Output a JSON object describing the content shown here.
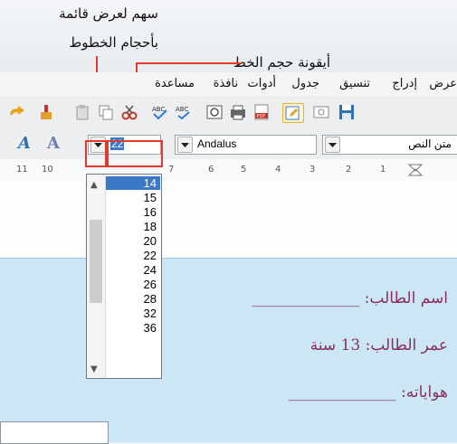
{
  "callouts": {
    "arrow_label_line1": "سهم لعرض قائمة",
    "arrow_label_line2": "بأحجام الخطوط",
    "icon_label": "أيقونة حجم الخط"
  },
  "menubar": {
    "items": [
      "عرض",
      "إدراج",
      "تنسيق",
      "جدول",
      "أدوات",
      "نافذة",
      "مساعدة"
    ]
  },
  "format_toolbar": {
    "paragraph_style": "متن النص",
    "font_name": "Andalus",
    "font_size": "22"
  },
  "ruler": {
    "ticks": [
      "11",
      "10",
      "7",
      "6",
      "5",
      "4",
      "3",
      "2",
      "1"
    ]
  },
  "font_size_list": {
    "options": [
      "14",
      "15",
      "16",
      "18",
      "20",
      "22",
      "24",
      "26",
      "28",
      "32",
      "36"
    ],
    "highlighted": "14"
  },
  "document": {
    "line1": "اسم الطالب: ______________",
    "line2": "عمر الطالب: 13 سنة",
    "line3": "هواياته: ______________"
  },
  "colors": {
    "accent_red": "#e03b2e",
    "selection_blue": "#3b78c8",
    "doc_blue": "#cbe6f6",
    "doc_text": "#8a2f5b"
  }
}
